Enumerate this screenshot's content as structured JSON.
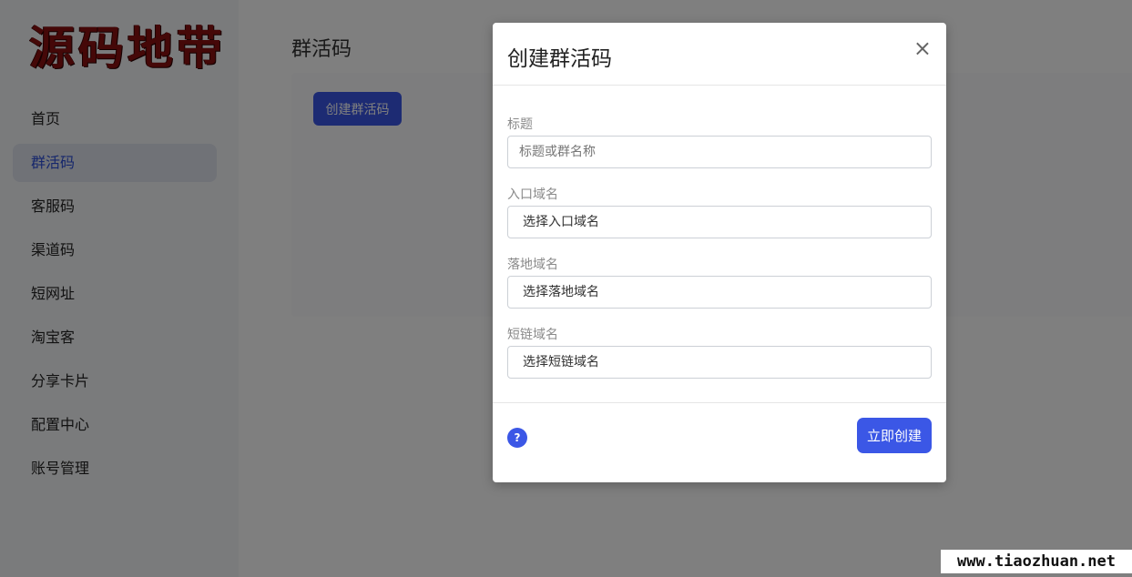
{
  "sidebar": {
    "logo_text": "源码地带",
    "items": [
      {
        "label": "首页"
      },
      {
        "label": "群活码",
        "active": true
      },
      {
        "label": "客服码"
      },
      {
        "label": "渠道码"
      },
      {
        "label": "短网址"
      },
      {
        "label": "淘宝客"
      },
      {
        "label": "分享卡片"
      },
      {
        "label": "配置中心"
      },
      {
        "label": "账号管理"
      }
    ]
  },
  "main": {
    "title": "群活码",
    "create_button": "创建群活码"
  },
  "modal": {
    "title": "创建群活码",
    "close_icon": "×",
    "fields": [
      {
        "label": "标题",
        "placeholder": "标题或群名称"
      },
      {
        "label": "入口域名",
        "value": "选择入口域名"
      },
      {
        "label": "落地域名",
        "value": "选择落地域名"
      },
      {
        "label": "短链域名",
        "value": "选择短链域名"
      }
    ],
    "help_icon": "?",
    "submit_button": "立即创建"
  },
  "watermark": "www.tiaozhuan.net",
  "colors": {
    "accent": "#3b57e6",
    "active_nav_text": "#2c4fd8",
    "overlay": "rgba(0,0,0,0.5)"
  }
}
